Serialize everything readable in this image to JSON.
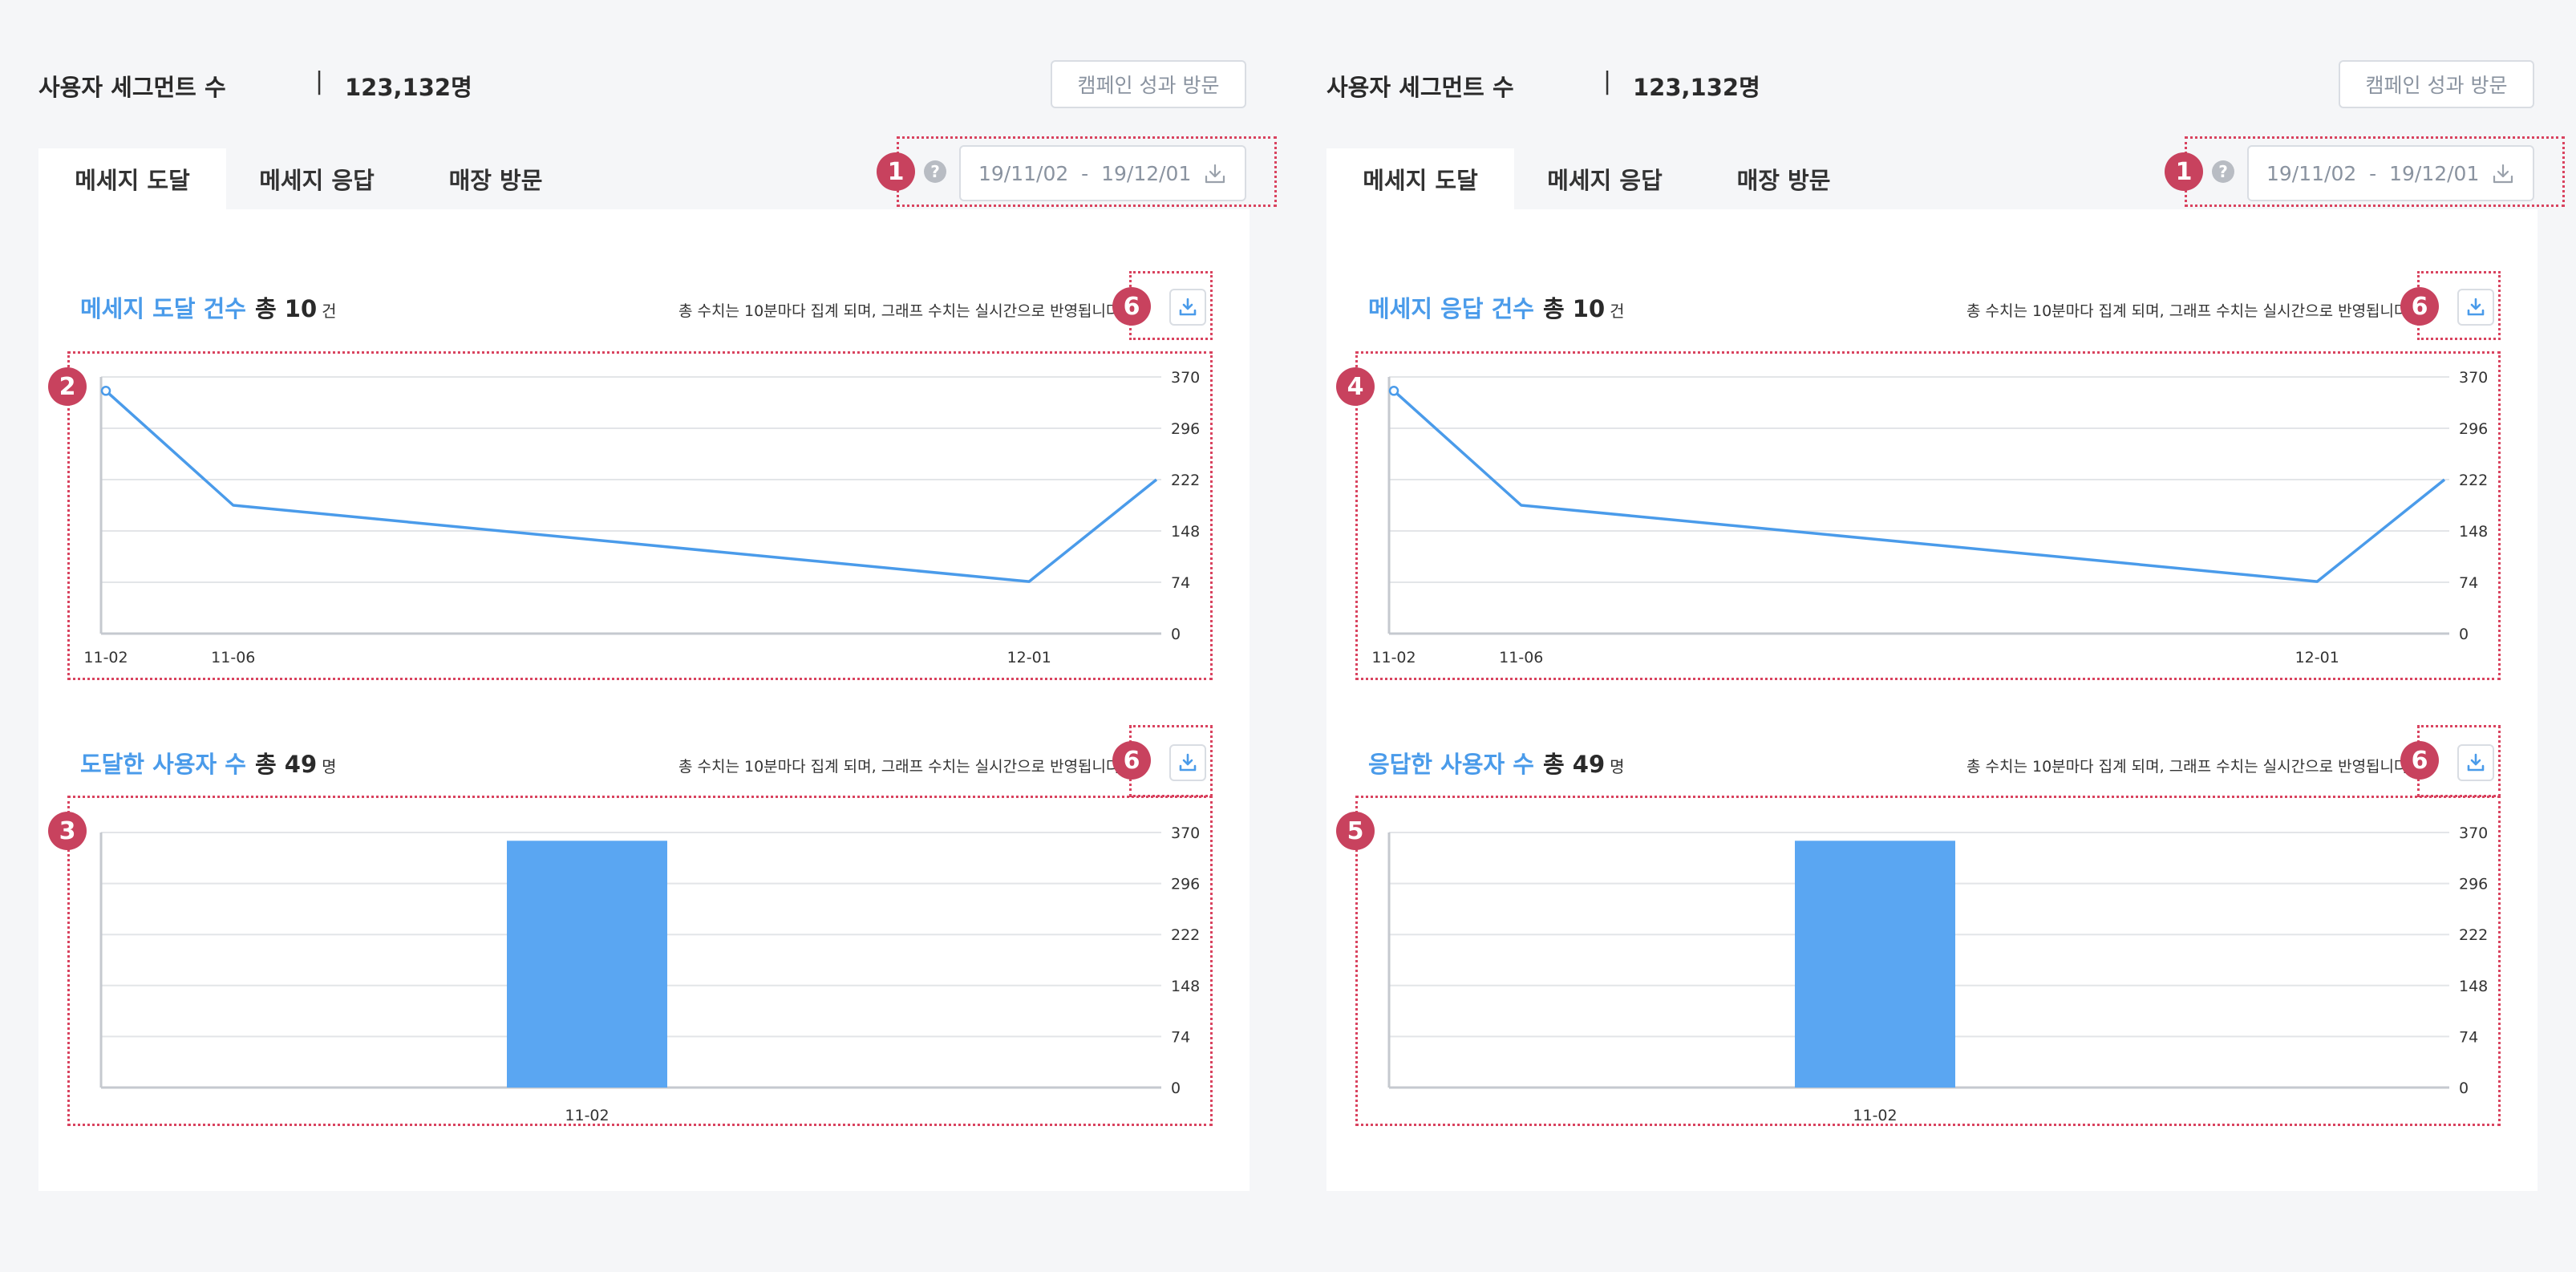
{
  "colors": {
    "accent": "#4a9bea",
    "bar": "#5aa6f2",
    "marker": "#c8425e",
    "annotation": "#d9435f"
  },
  "panels": [
    {
      "segment_label": "사용자 세그먼트 수",
      "separator": "|",
      "segment_count": "123,132명",
      "campaign_button": "캠페인 성과 방문",
      "tabs": [
        "메세지 도달",
        "메세지 응답",
        "매장 방문"
      ],
      "help_icon": "?",
      "date_range": "19/11/02  -  19/12/01",
      "marker_date": "1",
      "line_section": {
        "title": "메세지 도달 건수",
        "total": "총 10",
        "unit": "건",
        "note": "총 수치는 10분마다 집계 되며, 그래프 수치는 실시간으로 반영됩니다.",
        "marker_download": "6",
        "marker_chart": "2"
      },
      "bar_section": {
        "title": "도달한 사용자 수",
        "total": "총 49",
        "unit": "명",
        "note": "총 수치는 10분마다 집계 되며, 그래프 수치는 실시간으로 반영됩니다.",
        "marker_download": "6",
        "marker_chart": "3"
      }
    },
    {
      "segment_label": "사용자 세그먼트 수",
      "separator": "|",
      "segment_count": "123,132명",
      "campaign_button": "캠페인 성과 방문",
      "tabs": [
        "메세지 도달",
        "메세지 응답",
        "매장 방문"
      ],
      "help_icon": "?",
      "date_range": "19/11/02  -  19/12/01",
      "marker_date": "1",
      "line_section": {
        "title": "메세지 응답 건수",
        "total": "총 10",
        "unit": "건",
        "note": "총 수치는 10분마다 집계 되며, 그래프 수치는 실시간으로 반영됩니다.",
        "marker_download": "6",
        "marker_chart": "4"
      },
      "bar_section": {
        "title": "응답한 사용자 수",
        "total": "총 49",
        "unit": "명",
        "note": "총 수치는 10분마다 집계 되며, 그래프 수치는 실시간으로 반영됩니다.",
        "marker_download": "6",
        "marker_chart": "5"
      }
    }
  ],
  "chart_data": [
    {
      "type": "line",
      "x": [
        "11-02",
        "11-06",
        "12-01",
        "12-05"
      ],
      "x_tick_labels": [
        "11-02",
        "11-06",
        "12-01"
      ],
      "values": [
        350,
        185,
        75,
        222
      ],
      "y_ticks": [
        370,
        296,
        222,
        148,
        74,
        0
      ],
      "ylim": [
        0,
        370
      ],
      "y_axis_side": "right",
      "grid": true
    },
    {
      "type": "bar",
      "categories": [
        "11-02"
      ],
      "values": [
        358
      ],
      "y_ticks": [
        370,
        296,
        222,
        148,
        74,
        0
      ],
      "ylim": [
        0,
        370
      ],
      "y_axis_side": "right",
      "grid": true
    },
    {
      "type": "line",
      "x": [
        "11-02",
        "11-06",
        "12-01",
        "12-05"
      ],
      "x_tick_labels": [
        "11-02",
        "11-06",
        "12-01"
      ],
      "values": [
        350,
        185,
        75,
        222
      ],
      "y_ticks": [
        370,
        296,
        222,
        148,
        74,
        0
      ],
      "ylim": [
        0,
        370
      ],
      "y_axis_side": "right",
      "grid": true
    },
    {
      "type": "bar",
      "categories": [
        "11-02"
      ],
      "values": [
        358
      ],
      "y_ticks": [
        370,
        296,
        222,
        148,
        74,
        0
      ],
      "ylim": [
        0,
        370
      ],
      "y_axis_side": "right",
      "grid": true
    }
  ]
}
